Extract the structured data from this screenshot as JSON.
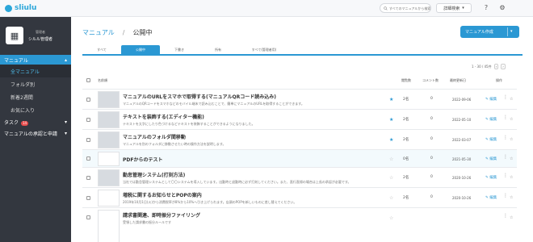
{
  "app": {
    "logo": "sliulu"
  },
  "topbar": {
    "search_placeholder": "すべてのマニュアルから検索",
    "advanced_search": "詳細検索",
    "help_icon": "help-icon",
    "settings_icon": "gear-icon"
  },
  "sidebar": {
    "user_role": "管理者",
    "user_name": "シルル管理者",
    "manual_label": "マニュアル",
    "items": [
      {
        "label": "全マニュアル",
        "active": true
      },
      {
        "label": "フォルダ別",
        "active": false
      },
      {
        "label": "新着2週間",
        "active": false
      },
      {
        "label": "お気に入り",
        "active": false
      }
    ],
    "task_label": "タスク",
    "task_count": "14",
    "approval_label": "マニュアルの承認と申請"
  },
  "breadcrumb": {
    "root": "マニュアル",
    "separator": "/",
    "current": "公開中"
  },
  "create_button": "マニュアル作成",
  "tabs": [
    {
      "label": "すべて",
      "active": false
    },
    {
      "label": "公開中",
      "active": true
    },
    {
      "label": "下書き",
      "active": false
    },
    {
      "label": "所有",
      "active": false
    },
    {
      "label": "すべて(管理者用)",
      "active": false
    }
  ],
  "pagination": {
    "range": "1 - 30 / 45件",
    "prev": "‹",
    "next": "›"
  },
  "table": {
    "headers": {
      "name": "名前順",
      "views": "閲覧数",
      "comments": "コメント数",
      "updated": "最終更新日",
      "actions": "操作"
    },
    "rows": [
      {
        "title": "マニュアルのURLをスマホで取得する(マニュアルQRコード読み込み)",
        "desc": "マニュアルのQRコードをスマホなどのモバイル端末で読み込むことで、簡単にマニュアルのURLを取得することができます。",
        "favorite": true,
        "views": "2名",
        "comments": "0",
        "date": "2022-09-06",
        "edit": "編集"
      },
      {
        "title": "テキストを装飾する(エディター機能)",
        "desc": "テキストを太字にしたり色づけるなどテキストを装飾することができるようになりました。",
        "favorite": true,
        "views": "2名",
        "comments": "0",
        "date": "2022-05-10",
        "edit": "編集"
      },
      {
        "title": "マニュアルのフォルダ間移動",
        "desc": "マニュアルを別のフォルダに移動させたい時の操作方法を説明します。",
        "favorite": true,
        "views": "2名",
        "comments": "0",
        "date": "2022-03-07",
        "edit": "編集"
      },
      {
        "title": "PDFからのテスト",
        "desc": "",
        "favorite": false,
        "views": "0名",
        "comments": "0",
        "date": "2021-05-30",
        "edit": "編集"
      },
      {
        "title": "勤怠管理システム(打刻方法)",
        "desc": "当社では勤怠管理システムとして〇〇システムを導入しています。出勤時と退勤時に必ず打刻してください。また、直行直帰の場合は上長の承認が必要です。",
        "favorite": false,
        "views": "2名",
        "comments": "0",
        "date": "2020-10-26",
        "edit": "編集"
      },
      {
        "title": "増税に関するお知らせとPOPの案内",
        "desc": "2019年10月1日(火)から消費税率が8%から10%へ引き上げられます。店頭のPOPを新しいものに差し替えてください。",
        "favorite": false,
        "views": "2名",
        "comments": "0",
        "date": "2020-10-26",
        "edit": "編集"
      },
      {
        "title": "請求書関連、即時振分ファイリング",
        "desc": "受領した請求書の振分ルールです",
        "favorite": false,
        "views": "",
        "comments": "",
        "date": "",
        "edit": ""
      }
    ]
  }
}
